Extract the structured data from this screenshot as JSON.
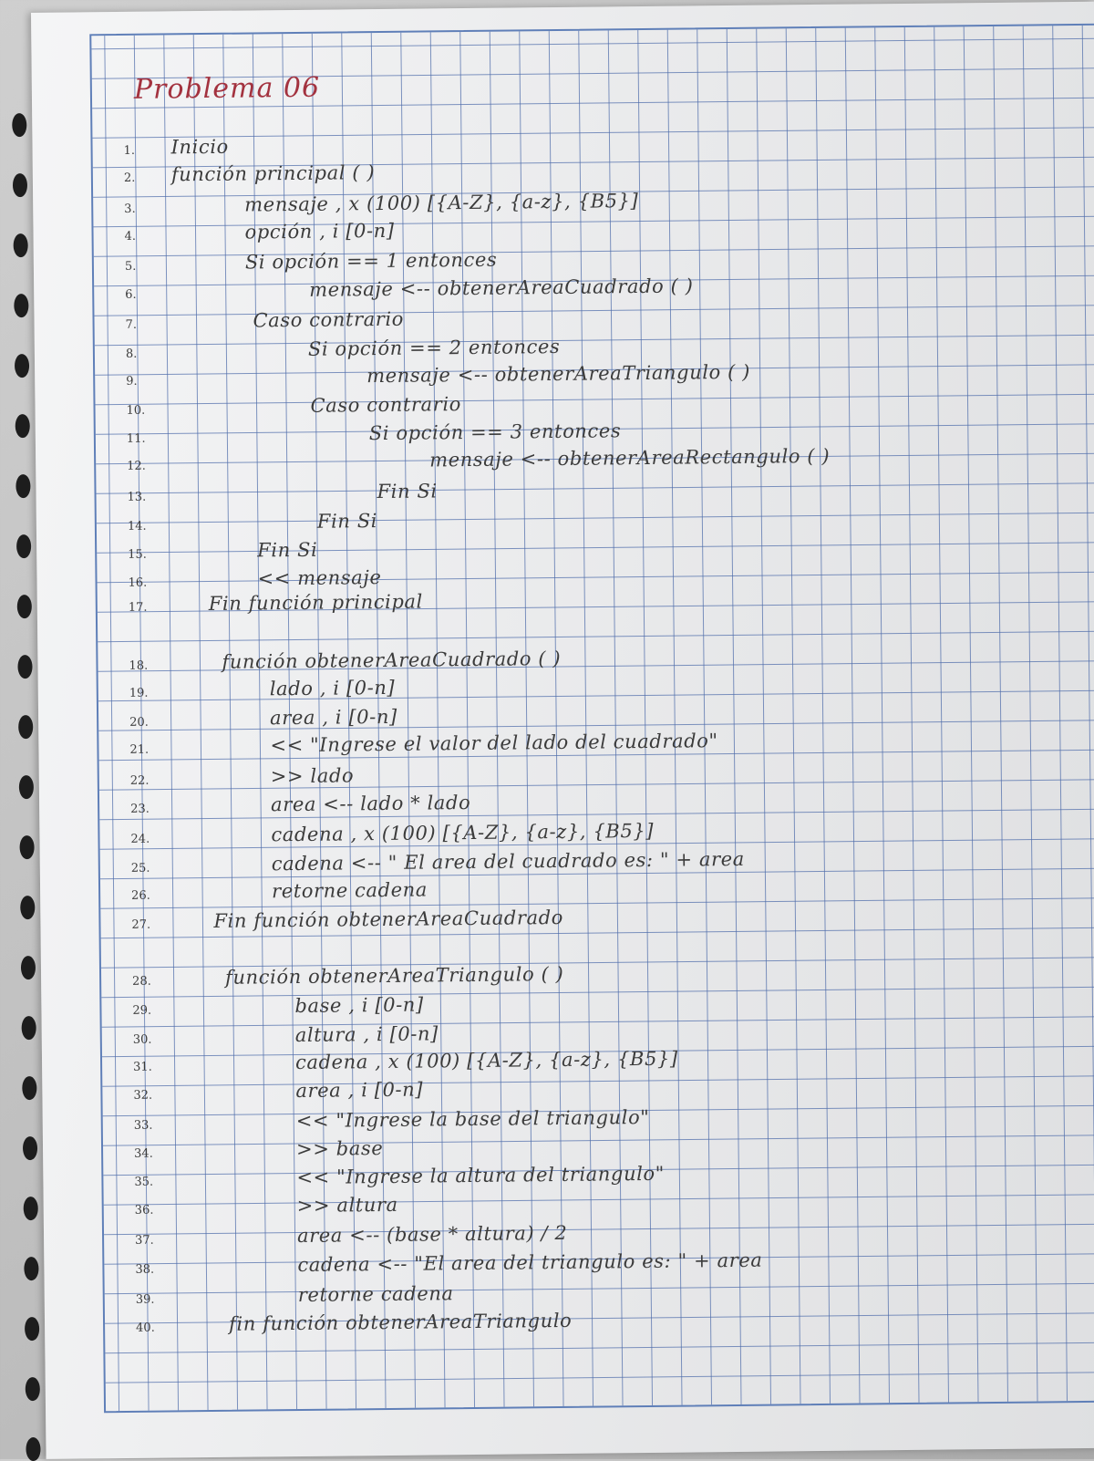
{
  "title": "Problema 06",
  "lines": [
    {
      "number": "1.",
      "text": "Inicio"
    },
    {
      "number": "2.",
      "text": "función principal ( )"
    },
    {
      "number": "3.",
      "text": "mensaje , x (100) [{A-Z}, {a-z}, {B5}]"
    },
    {
      "number": "4.",
      "text": "opción , i [0-n]"
    },
    {
      "number": "5.",
      "text": "Si opción == 1 entonces"
    },
    {
      "number": "6.",
      "text": "mensaje <-- obtenerAreaCuadrado ( )"
    },
    {
      "number": "7.",
      "text": "Caso contrario"
    },
    {
      "number": "8.",
      "text": "Si opción == 2 entonces"
    },
    {
      "number": "9.",
      "text": "mensaje <-- obtenerAreaTriangulo ( )"
    },
    {
      "number": "10.",
      "text": "Caso contrario"
    },
    {
      "number": "11.",
      "text": "Si opción == 3 entonces"
    },
    {
      "number": "12.",
      "text": "mensaje <-- obtenerAreaRectangulo ( )"
    },
    {
      "number": "13.",
      "text": "Fin Si"
    },
    {
      "number": "14.",
      "text": "Fin Si"
    },
    {
      "number": "15.",
      "text": "Fin Si"
    },
    {
      "number": "16.",
      "text": "<< mensaje"
    },
    {
      "number": "17.",
      "text": "Fin función principal"
    },
    {
      "number": "18.",
      "text": "función obtenerAreaCuadrado ( )"
    },
    {
      "number": "19.",
      "text": "lado , i [0-n]"
    },
    {
      "number": "20.",
      "text": "area , i [0-n]"
    },
    {
      "number": "21.",
      "text": "<< \"Ingrese el valor del lado del cuadrado\""
    },
    {
      "number": "22.",
      "text": ">> lado"
    },
    {
      "number": "23.",
      "text": "area <-- lado * lado"
    },
    {
      "number": "24.",
      "text": "cadena , x (100) [{A-Z}, {a-z}, {B5}]"
    },
    {
      "number": "25.",
      "text": "cadena <-- \" El area del cuadrado es: \" + area"
    },
    {
      "number": "26.",
      "text": "retorne cadena"
    },
    {
      "number": "27.",
      "text": "Fin función obtenerAreaCuadrado"
    },
    {
      "number": "28.",
      "text": "función obtenerAreaTriangulo ( )"
    },
    {
      "number": "29.",
      "text": "base , i [0-n]"
    },
    {
      "number": "30.",
      "text": "altura , i [0-n]"
    },
    {
      "number": "31.",
      "text": "cadena , x (100) [{A-Z}, {a-z}, {B5}]"
    },
    {
      "number": "32.",
      "text": "area , i [0-n]"
    },
    {
      "number": "33.",
      "text": "<< \"Ingrese la base del triangulo\""
    },
    {
      "number": "34.",
      "text": ">> base"
    },
    {
      "number": "35.",
      "text": "<< \"Ingrese la altura del triangulo\""
    },
    {
      "number": "36.",
      "text": ">> altura"
    },
    {
      "number": "37.",
      "text": "area <-- (base * altura) / 2"
    },
    {
      "number": "38.",
      "text": "cadena <-- \"El area del triangulo es: \" + area"
    },
    {
      "number": "39.",
      "text": "retorne cadena"
    },
    {
      "number": "40.",
      "text": "fin función obtenerAreaTriangulo"
    }
  ]
}
